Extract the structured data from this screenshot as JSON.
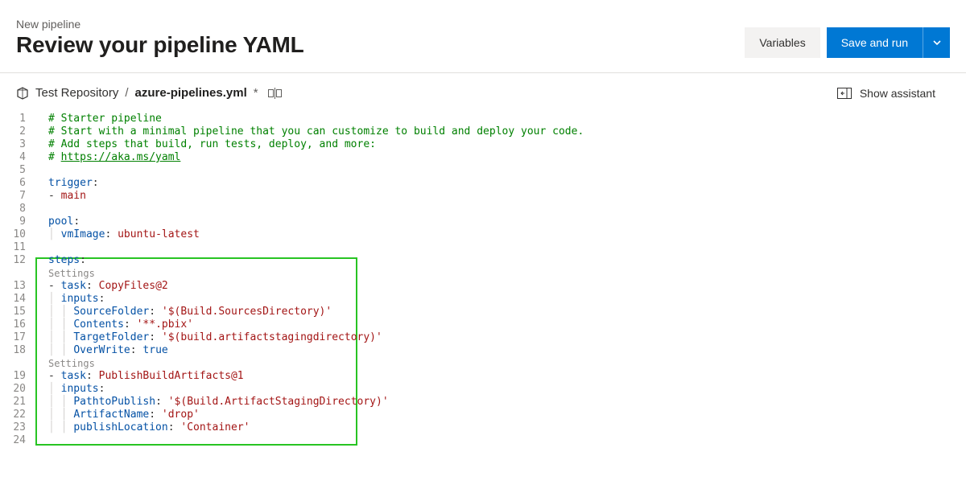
{
  "header": {
    "breadcrumb": "New pipeline",
    "title": "Review your pipeline YAML",
    "variables_btn": "Variables",
    "save_run_btn": "Save and run"
  },
  "path": {
    "repo": "Test Repository",
    "separator": "/",
    "file": "azure-pipelines.yml",
    "dirty": "*"
  },
  "assistant": {
    "label": "Show assistant"
  },
  "lines": {
    "n1": "1",
    "n2": "2",
    "n3": "3",
    "n4": "4",
    "n5": "5",
    "n6": "6",
    "n7": "7",
    "n8": "8",
    "n9": "9",
    "n10": "10",
    "n11": "11",
    "n12": "12",
    "n13": "13",
    "n14": "14",
    "n15": "15",
    "n16": "16",
    "n17": "17",
    "n18": "18",
    "n19": "19",
    "n20": "20",
    "n21": "21",
    "n22": "22",
    "n23": "23",
    "n24": "24"
  },
  "code": {
    "c1": "# Starter pipeline",
    "c2": "# Start with a minimal pipeline that you can customize to build and deploy your code.",
    "c3": "# Add steps that build, run tests, deploy, and more:",
    "c4_prefix": "# ",
    "c4_link": "https://aka.ms/yaml",
    "trigger_key": "trigger",
    "colon": ":",
    "dash": "- ",
    "main": "main",
    "pool_key": "pool",
    "vmimage_key": "vmImage",
    "vmimage_val": "ubuntu-latest",
    "steps_key": "steps",
    "settings_hint": "Settings",
    "task_key": "task",
    "task1_val": "CopyFiles@2",
    "inputs_key": "inputs",
    "sourcefolder_key": "SourceFolder",
    "sourcefolder_val": "'$(Build.SourcesDirectory)'",
    "contents_key": "Contents",
    "contents_val": "'**.pbix'",
    "targetfolder_key": "TargetFolder",
    "targetfolder_val": "'$(build.artifactstagingdirectory)'",
    "overwrite_key": "OverWrite",
    "overwrite_val": "true",
    "task2_val": "PublishBuildArtifacts@1",
    "pathpublish_key": "PathtoPublish",
    "pathpublish_val": "'$(Build.ArtifactStagingDirectory)'",
    "artifactname_key": "ArtifactName",
    "artifactname_val": "'drop'",
    "publishlocation_key": "publishLocation",
    "publishlocation_val": "'Container'",
    "indent2": "  ",
    "indent4": "    "
  }
}
